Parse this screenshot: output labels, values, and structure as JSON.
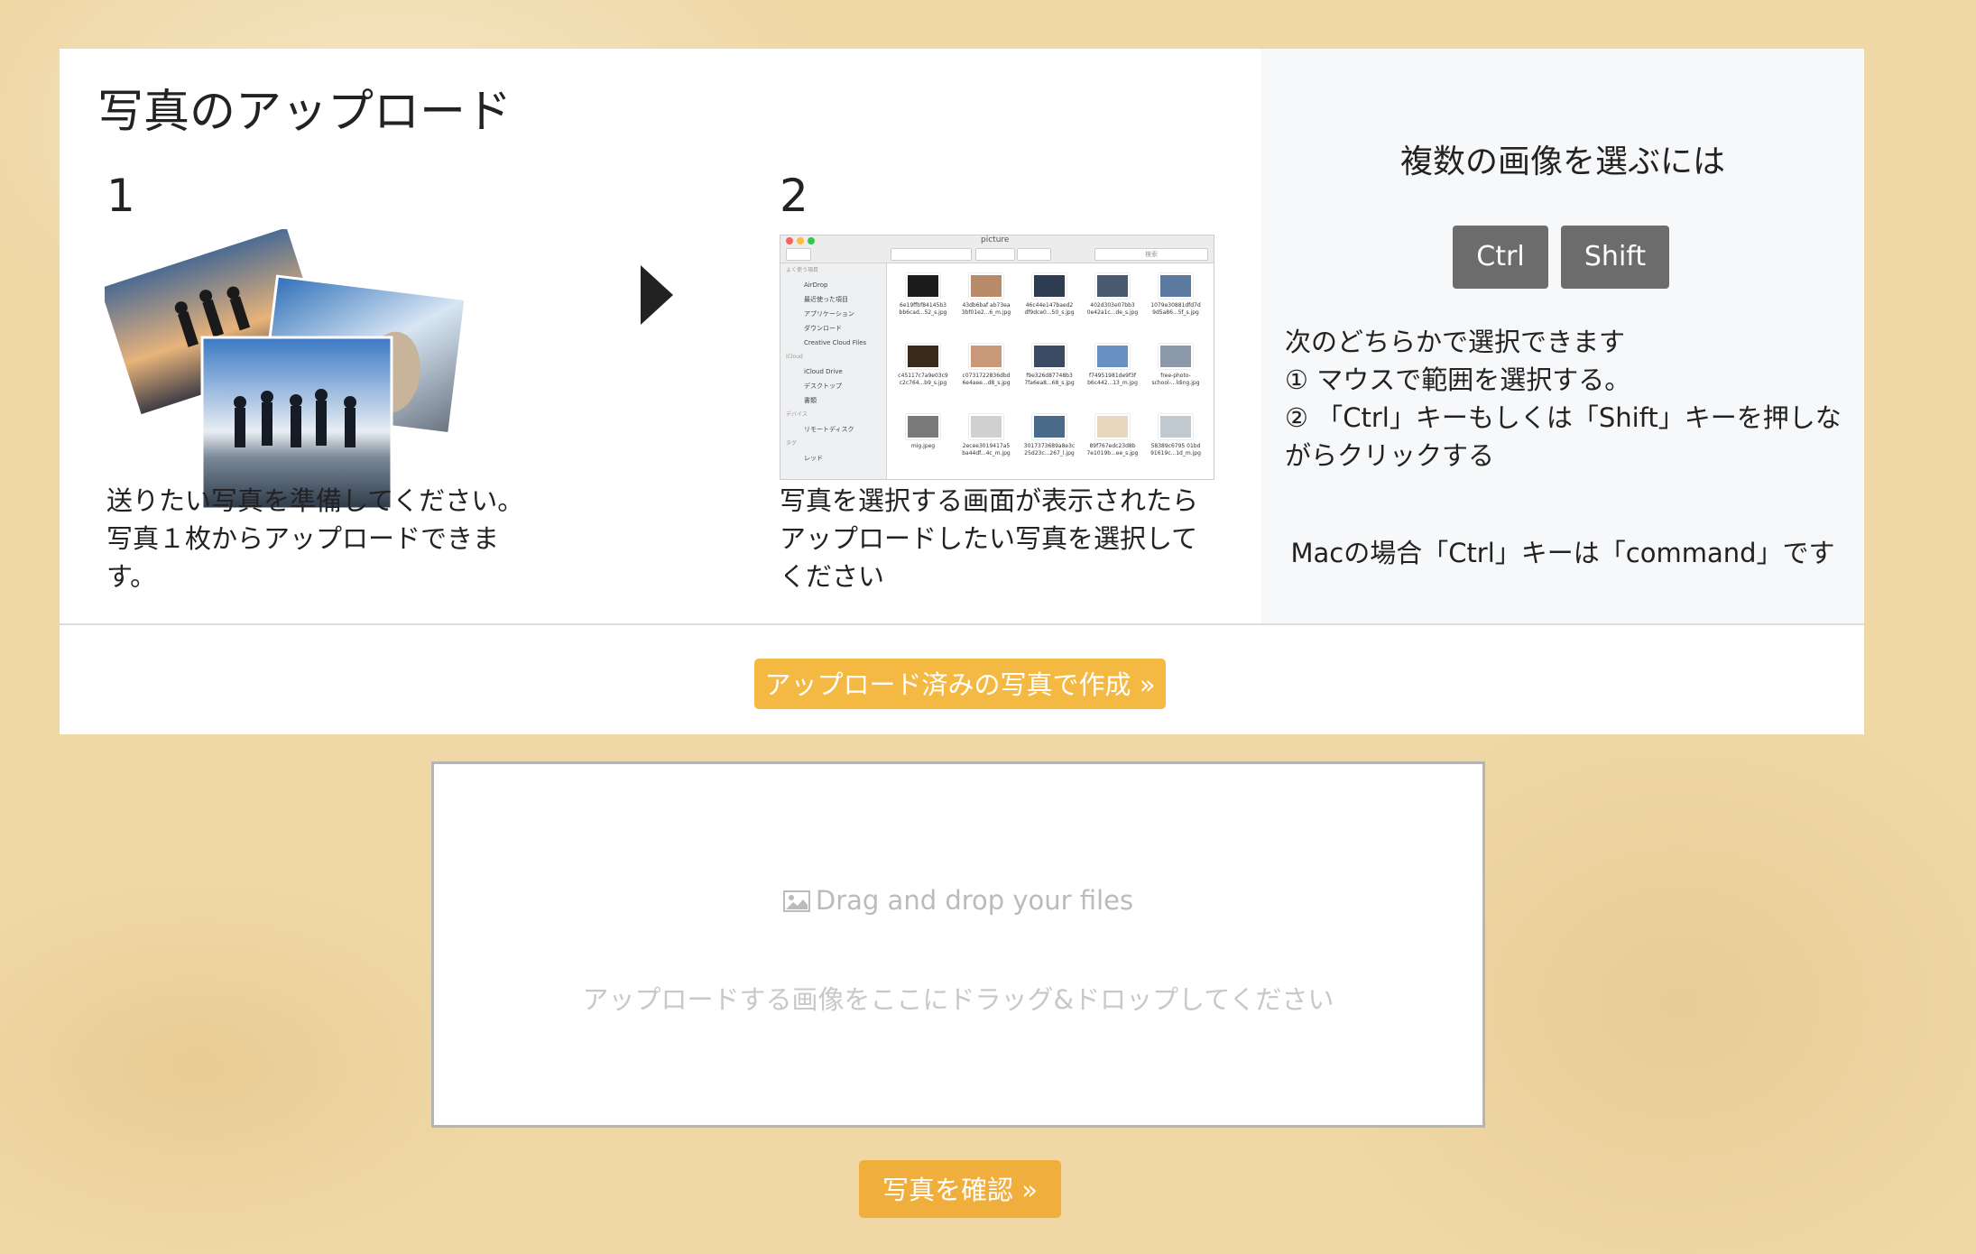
{
  "header": {
    "title": "写真のアップロード"
  },
  "step1": {
    "number": "1",
    "text_line1": "送りたい写真を準備してください。",
    "text_line2": "写真１枚からアップロードできま",
    "text_line3": "す。"
  },
  "step2": {
    "number": "2",
    "text_line1": "写真を選択する画面が表示されたら",
    "text_line2": "アップロードしたい写真を選択して",
    "text_line3": "ください",
    "finder": {
      "window_title": "picture",
      "search_placeholder": "検索",
      "sidebar_heading_favorites": "よく使う項目",
      "sidebar_items": [
        "AirDrop",
        "最近使った項目",
        "アプリケーション",
        "ダウンロード",
        "Creative Cloud Files"
      ],
      "sidebar_heading_icloud": "iCloud",
      "icloud_items": [
        "iCloud Drive",
        "デスクトップ",
        "書類"
      ],
      "sidebar_heading_devices": "デバイス",
      "device_items": [
        "リモートディスク"
      ],
      "sidebar_heading_tags": "タグ",
      "tag_items": [
        "レッド"
      ],
      "files": [
        [
          "6e19ffbf84145b3",
          "bb6cad...52_s.jpg"
        ],
        [
          "43db6baf ab73ea",
          "3bf01e2...6_m.jpg"
        ],
        [
          "46c44e147baed2",
          "df9dce0...50_s.jpg"
        ],
        [
          "402d303e07bb3",
          "0e42a1c...de_s.jpg"
        ],
        [
          "1079e30881dfd7d",
          "9d5a86...5f_s.jpg"
        ],
        [
          "c45117c7a9e03c9",
          "c2c764...b9_s.jpg"
        ],
        [
          "c0731722836dbd",
          "6e4aee...d8_s.jpg"
        ],
        [
          "f9e326d87748b3",
          "7fa6ea8...68_s.jpg"
        ],
        [
          "f74951981de9f3f",
          "b6c442...13_m.jpg"
        ],
        [
          "free-photo-",
          "school-...lding.jpg"
        ],
        [
          "mig.jpeg",
          ""
        ],
        [
          "2ecee3019417a5",
          "ba44df...4c_m.jpg"
        ],
        [
          "3017373689a8e3c",
          "25d23c...267_l.jpg"
        ],
        [
          "89f767edc23d8b",
          "7e1019b...ee_s.jpg"
        ],
        [
          "58389c6795 01bd",
          "91619c...1d_m.jpg"
        ]
      ]
    }
  },
  "side": {
    "title": "複数の画像を選ぶには",
    "keys": [
      "Ctrl",
      "Shift"
    ],
    "line1": "次のどちらかで選択できます",
    "line2": "① マウスで範囲を選択する。",
    "line3": "② 「Ctrl」キーもしくは「Shift」キーを押しな",
    "line4": "がらクリックする",
    "note": "Macの場合「Ctrl」キーは「command」です"
  },
  "buttons": {
    "create_uploaded": "アップロード済みの写真で作成 »",
    "confirm": "写真を確認 »"
  },
  "dropzone": {
    "title": "Drag and drop your files",
    "subtitle": "アップロードする画像をここにドラッグ&ドロップしてください"
  },
  "colors": {
    "accent": "#f4b943",
    "key_gray": "#6c6c6c"
  }
}
